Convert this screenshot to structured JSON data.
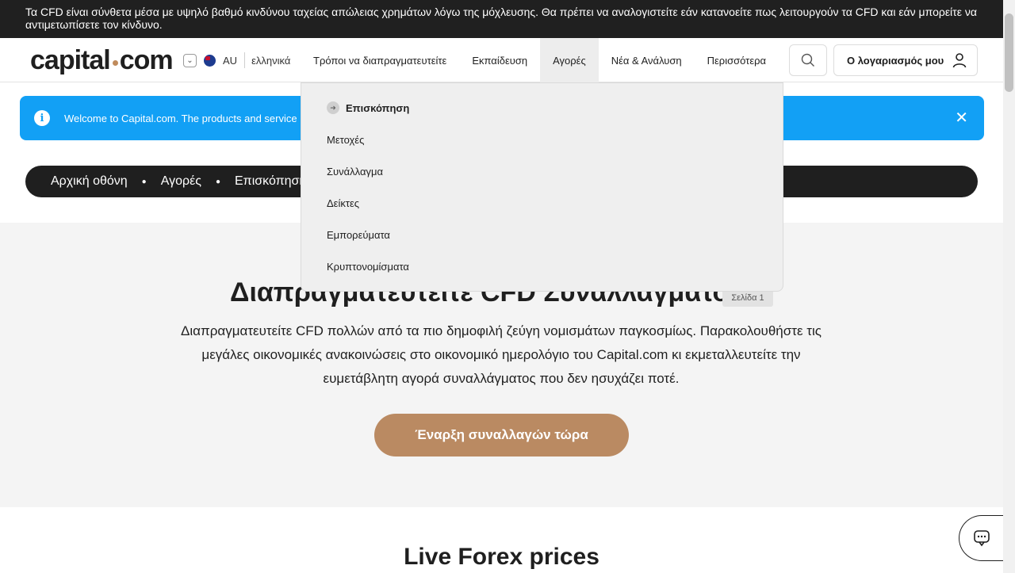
{
  "risk_warning": "Τα CFD είναι σύνθετα μέσα με υψηλό βαθμό κινδύνου ταχείας απώλειας χρημάτων λόγω της μόχλευσης. Θα πρέπει να αναλογιστείτε εάν κατανοείτε πως λειτουργούν τα CFD και εάν μπορείτε να αντιμετωπίσετε τον κίνδυνο.",
  "header": {
    "logo_left": "capital",
    "logo_right": "com",
    "region_code": "AU",
    "language": "ελληνικά",
    "nav": [
      {
        "label": "Τρόποι να διαπραγματευτείτε"
      },
      {
        "label": "Εκπαίδευση"
      },
      {
        "label": "Αγορές"
      },
      {
        "label": "Νέα & Ανάλυση"
      },
      {
        "label": "Περισσότερα"
      }
    ],
    "account_label": "Ο λογαριασμός μου"
  },
  "banner": {
    "text": "Welcome to Capital.com. The products and service"
  },
  "breadcrumbs": [
    "Αρχική οθόνη",
    "Αγορές",
    "Επισκόπηση"
  ],
  "hero": {
    "title": "Διαπραγματευτείτε CFD Συναλλάγματος",
    "page_badge": "Σελίδα 1",
    "description": "Διαπραγματευτείτε CFD πολλών από τα πιο δημοφιλή ζεύγη νομισμάτων παγκοσμίως. Παρακολουθήστε τις μεγάλες οικονομικές ανακοινώσεις στο οικονομικό ημερολόγιο του Capital.com κι εκμεταλλευτείτε την ευμετάβλητη αγορά συναλλάγματος που δεν ησυχάζει ποτέ.",
    "cta_label": "Έναρξη συναλλαγών τώρα"
  },
  "markets_dropdown": {
    "overview": "Επισκόπηση",
    "items": [
      "Μετοχές",
      "Συνάλλαγμα",
      "Δείκτες",
      "Εμπορεύματα",
      "Κρυπτονομίσματα"
    ]
  },
  "section_title": "Live Forex prices",
  "colors": {
    "accent_bronze": "#ba8a62",
    "banner_blue": "#12a0f5",
    "dark": "#1f1f1f"
  }
}
